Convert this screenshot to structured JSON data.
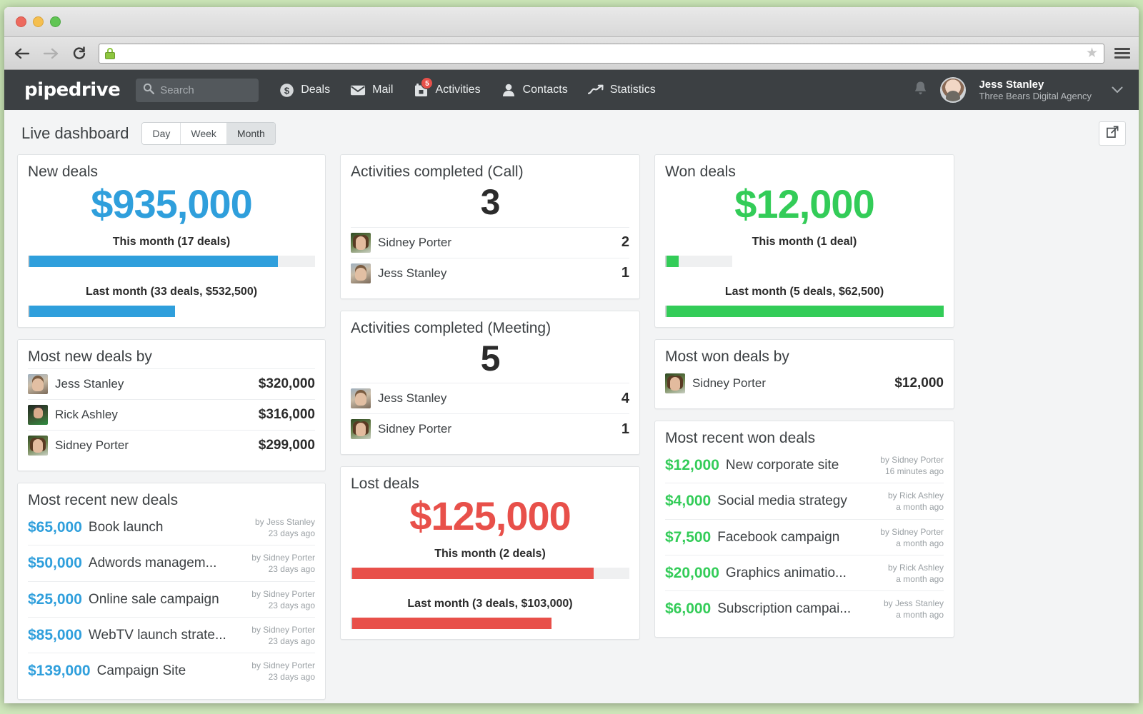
{
  "browser": {
    "url": "",
    "back_icon": "back-arrow-icon",
    "forward_icon": "forward-arrow-icon",
    "reload_icon": "reload-icon",
    "lock_icon": "ssl-lock-icon",
    "bookmark_icon": "star-icon",
    "menu_icon": "hamburger-menu-icon"
  },
  "appnav": {
    "logo": "pipedrive",
    "search_placeholder": "Search",
    "search_value": "",
    "items": [
      {
        "label": "Deals",
        "icon": "dollar-circle-icon",
        "badge": ""
      },
      {
        "label": "Mail",
        "icon": "envelope-icon",
        "badge": ""
      },
      {
        "label": "Activities",
        "icon": "calendar-icon",
        "badge": "5"
      },
      {
        "label": "Contacts",
        "icon": "person-icon",
        "badge": ""
      },
      {
        "label": "Statistics",
        "icon": "trend-up-icon",
        "badge": ""
      }
    ],
    "notification_icon": "bell-icon",
    "user_name": "Jess Stanley",
    "user_company": "Three Bears Digital Agency",
    "chevron": "⌄"
  },
  "dashboard": {
    "title": "Live dashboard",
    "range_options": [
      "Day",
      "Week",
      "Month"
    ],
    "range_selected": "Month",
    "expand_label": "expand-icon"
  },
  "cards": {
    "new_deals": {
      "title": "New deals",
      "amount": "$935,000",
      "this_month_label": "This month (17 deals)",
      "last_month_label": "Last month (33 deals, $532,500)",
      "this_month_pct": 87,
      "last_month_pct": 51
    },
    "most_new_deals_by": {
      "title": "Most new deals by",
      "rows": [
        {
          "name": "Jess Stanley",
          "value": "$320,000",
          "avatar": "jess"
        },
        {
          "name": "Rick Ashley",
          "value": "$316,000",
          "avatar": "rick"
        },
        {
          "name": "Sidney Porter",
          "value": "$299,000",
          "avatar": "sidney"
        }
      ]
    },
    "most_recent_new_deals": {
      "title": "Most recent new deals",
      "rows": [
        {
          "amount": "$65,000",
          "name": "Book launch",
          "by": "by Jess Stanley",
          "when": "23 days ago"
        },
        {
          "amount": "$50,000",
          "name": "Adwords managem...",
          "by": "by Sidney Porter",
          "when": "23 days ago"
        },
        {
          "amount": "$25,000",
          "name": "Online sale campaign",
          "by": "by Sidney Porter",
          "when": "23 days ago"
        },
        {
          "amount": "$85,000",
          "name": "WebTV launch strate...",
          "by": "by Sidney Porter",
          "when": "23 days ago"
        },
        {
          "amount": "$139,000",
          "name": "Campaign Site",
          "by": "by Sidney Porter",
          "when": "23 days ago"
        }
      ]
    },
    "activities_call": {
      "title": "Activities completed (Call)",
      "count": "3",
      "rows": [
        {
          "name": "Sidney Porter",
          "value": "2",
          "avatar": "sidney"
        },
        {
          "name": "Jess Stanley",
          "value": "1",
          "avatar": "jess"
        }
      ]
    },
    "activities_meeting": {
      "title": "Activities completed (Meeting)",
      "count": "5",
      "rows": [
        {
          "name": "Jess Stanley",
          "value": "4",
          "avatar": "jess"
        },
        {
          "name": "Sidney Porter",
          "value": "1",
          "avatar": "sidney"
        }
      ]
    },
    "lost_deals": {
      "title": "Lost deals",
      "amount": "$125,000",
      "this_month_label": "This month (2 deals)",
      "last_month_label": "Last month (3 deals, $103,000)",
      "this_month_pct": 87,
      "last_month_pct": 72
    },
    "won_deals": {
      "title": "Won deals",
      "amount": "$12,000",
      "this_month_label": "This month (1 deal)",
      "last_month_label": "Last month (5 deals, $62,500)",
      "this_month_pct": 19,
      "last_month_pct": 100
    },
    "most_won_deals_by": {
      "title": "Most won deals by",
      "rows": [
        {
          "name": "Sidney Porter",
          "value": "$12,000",
          "avatar": "sidney"
        }
      ]
    },
    "most_recent_won_deals": {
      "title": "Most recent won deals",
      "rows": [
        {
          "amount": "$12,000",
          "name": "New corporate site",
          "by": "by Sidney Porter",
          "when": "16 minutes ago"
        },
        {
          "amount": "$4,000",
          "name": "Social media strategy",
          "by": "by Rick Ashley",
          "when": "a month ago"
        },
        {
          "amount": "$7,500",
          "name": "Facebook campaign",
          "by": "by Sidney Porter",
          "when": "a month ago"
        },
        {
          "amount": "$20,000",
          "name": "Graphics animatio...",
          "by": "by Rick Ashley",
          "when": "a month ago"
        },
        {
          "amount": "$6,000",
          "name": "Subscription campai...",
          "by": "by Jess Stanley",
          "when": "a month ago"
        }
      ]
    }
  },
  "colors": {
    "blue": "#2f9fdc",
    "green": "#33cc58",
    "red": "#e8504a",
    "navbar": "#3c4043"
  }
}
